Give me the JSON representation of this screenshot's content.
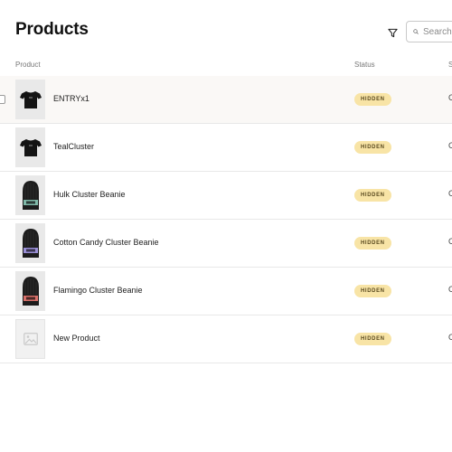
{
  "header": {
    "title": "Products",
    "filter_icon": "filter-icon",
    "search": {
      "placeholder": "Search",
      "value": "",
      "icon": "search-icon"
    }
  },
  "table": {
    "columns": {
      "product": "Product",
      "status": "Status",
      "extra": "S"
    },
    "rows": [
      {
        "name": "ENTRYx1",
        "status": "HIDDEN",
        "extra": "C",
        "thumbnail": "black-tshirt"
      },
      {
        "name": "TealCluster",
        "status": "HIDDEN",
        "extra": "C",
        "thumbnail": "black-tshirt"
      },
      {
        "name": "Hulk Cluster Beanie",
        "status": "HIDDEN",
        "extra": "C",
        "thumbnail": "black-beanie-green"
      },
      {
        "name": "Cotton Candy Cluster Beanie",
        "status": "HIDDEN",
        "extra": "C",
        "thumbnail": "black-beanie-purple"
      },
      {
        "name": "Flamingo Cluster Beanie",
        "status": "HIDDEN",
        "extra": "C",
        "thumbnail": "black-beanie-red"
      },
      {
        "name": "New Product",
        "status": "HIDDEN",
        "extra": "C",
        "thumbnail": "image-placeholder"
      }
    ]
  },
  "colors": {
    "status_badge_bg": "#f8e4a6",
    "status_badge_text": "#5a4a1f",
    "row_highlight": "#faf8f6",
    "beanie_patch_green": "#7fb8a8",
    "beanie_patch_purple": "#9a8fd6",
    "beanie_patch_red": "#d8706a"
  }
}
